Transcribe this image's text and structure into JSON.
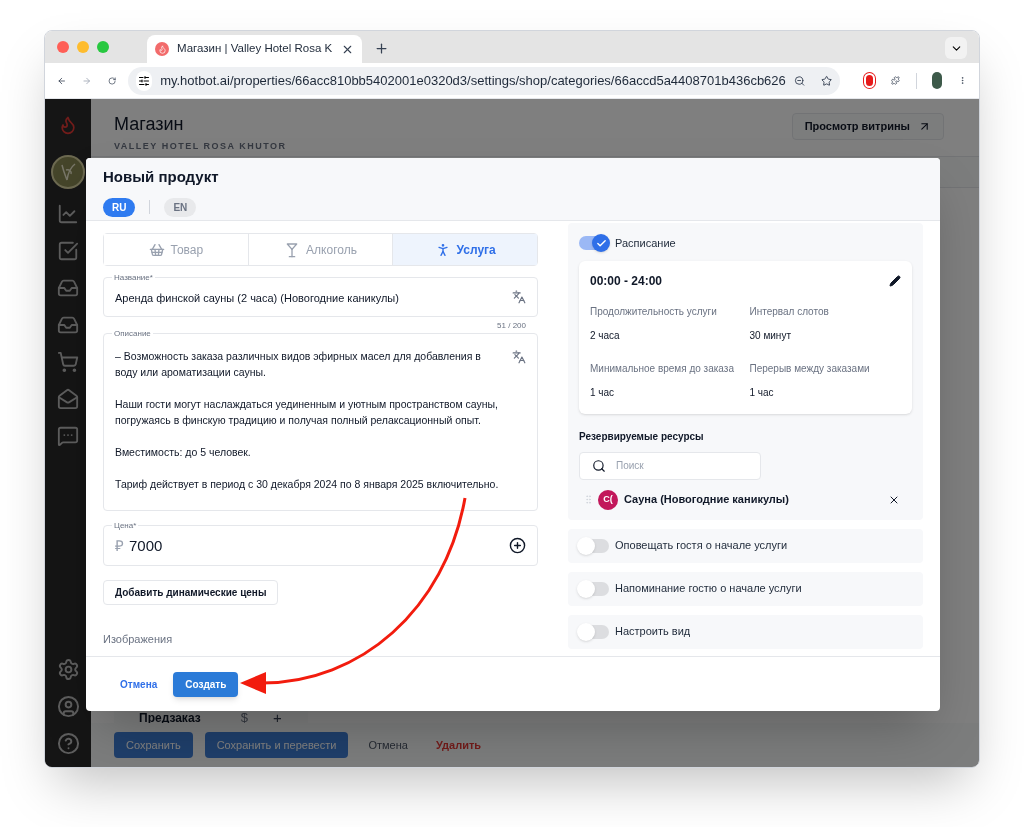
{
  "browser": {
    "tab_title": "Магазин | Valley Hotel Rosa K",
    "url": "my.hotbot.ai/properties/66acc810bb5402001e0320d3/settings/shop/categories/66accd5a4408701b436cb626"
  },
  "page": {
    "title": "Магазин",
    "subtitle": "VALLEY HOTEL ROSA KHUTOR",
    "storefront_button": "Просмотр витрины",
    "preorder_label": "Предзаказ",
    "currency_symbol": "$",
    "add_symbol": "+",
    "actions": [
      {
        "label": "Сохранить",
        "kind": "primary"
      },
      {
        "label": "Сохранить и перевести",
        "kind": "primary"
      },
      {
        "label": "Отмена",
        "kind": "text"
      },
      {
        "label": "Удалить",
        "kind": "danger"
      }
    ]
  },
  "modal": {
    "title": "Новый продукт",
    "languages": [
      {
        "label": "RU",
        "selected": true
      },
      {
        "label": "EN",
        "selected": false
      }
    ],
    "product_types": [
      {
        "label": "Товар",
        "kind": "goods",
        "selected": false
      },
      {
        "label": "Алкоголь",
        "kind": "alcohol",
        "selected": false
      },
      {
        "label": "Услуга",
        "kind": "service",
        "selected": true
      }
    ],
    "name_field": {
      "label": "Название*",
      "value": "Аренда финской сауны (2 часа) (Новогодние каникулы)"
    },
    "char_count": "51 / 200",
    "description_field": {
      "label": "Описание",
      "paragraphs": [
        "– Возможность заказа различных видов эфирных масел для добавления в воду или ароматизации сауны.",
        "Наши гости могут наслаждаться уединенным и уютным пространством сауны, погружаясь в финскую традицию и получая полный релаксационный опыт.",
        "Вместимость: до 5 человек.",
        "Тариф действует в период с 30 декабря 2024 по 8 января 2025 включительно."
      ]
    },
    "price_field": {
      "label": "Цена*",
      "currency": "₽",
      "value": "7000"
    },
    "dynamic_prices_button": "Добавить динамические цены",
    "images_label": "Изображения",
    "schedule": {
      "label": "Расписание",
      "on": true,
      "time_range": "00:00 - 24:00",
      "details": [
        {
          "label": "Продолжительность услуги",
          "value": "2 часа"
        },
        {
          "label": "Интервал слотов",
          "value": "30 минут"
        },
        {
          "label": "Минимальное время до заказа",
          "value": "1 час"
        },
        {
          "label": "Перерыв между заказами",
          "value": "1 час"
        }
      ]
    },
    "resources": {
      "label": "Резервируемые ресурсы",
      "search_placeholder": "Поиск",
      "items": [
        {
          "initials": "С(",
          "name": "Сауна (Новогодние каникулы)",
          "color": "#c2185b"
        }
      ]
    },
    "toggles": [
      {
        "label": "Оповещать гостя о начале услуги",
        "on": false
      },
      {
        "label": "Напоминание гостю о начале услуги",
        "on": false
      },
      {
        "label": "Настроить вид",
        "on": false
      }
    ],
    "cancel_button": "Отмена",
    "create_button": "Создать"
  }
}
